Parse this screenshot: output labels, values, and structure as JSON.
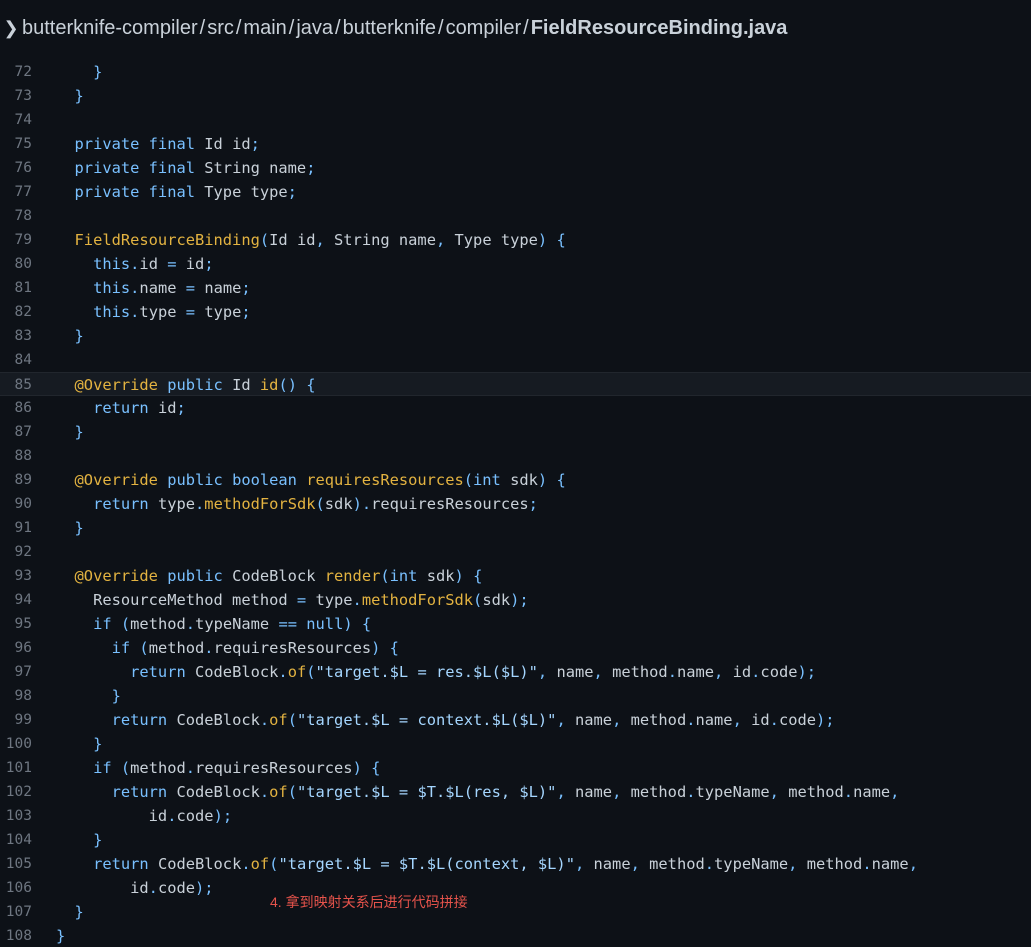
{
  "breadcrumb": {
    "parts": [
      "butterknife-compiler",
      "src",
      "main",
      "java",
      "butterknife",
      "compiler"
    ],
    "current": "FieldResourceBinding.java"
  },
  "lines": [
    {
      "n": "72",
      "t": [
        [
          "pl",
          "    }"
        ]
      ]
    },
    {
      "n": "73",
      "t": [
        [
          "pl",
          "  }"
        ]
      ]
    },
    {
      "n": "74",
      "t": []
    },
    {
      "n": "75",
      "t": [
        [
          "kw",
          "  private final "
        ],
        [
          "id",
          "Id id"
        ],
        [
          "pl",
          ";"
        ]
      ]
    },
    {
      "n": "76",
      "t": [
        [
          "kw",
          "  private final "
        ],
        [
          "id",
          "String name"
        ],
        [
          "pl",
          ";"
        ]
      ]
    },
    {
      "n": "77",
      "t": [
        [
          "kw",
          "  private final "
        ],
        [
          "id",
          "Type type"
        ],
        [
          "pl",
          ";"
        ]
      ]
    },
    {
      "n": "78",
      "t": []
    },
    {
      "n": "79",
      "t": [
        [
          "fnc",
          "  FieldResourceBinding"
        ],
        [
          "pl",
          "("
        ],
        [
          "id",
          "Id id"
        ],
        [
          "pl",
          ", "
        ],
        [
          "id",
          "String name"
        ],
        [
          "pl",
          ", "
        ],
        [
          "id",
          "Type type"
        ],
        [
          "pl",
          ") {"
        ]
      ]
    },
    {
      "n": "80",
      "t": [
        [
          "kw",
          "    this"
        ],
        [
          "pl",
          "."
        ],
        [
          "id",
          "id"
        ],
        [
          "pl",
          " = "
        ],
        [
          "id",
          "id"
        ],
        [
          "pl",
          ";"
        ]
      ]
    },
    {
      "n": "81",
      "t": [
        [
          "kw",
          "    this"
        ],
        [
          "pl",
          "."
        ],
        [
          "id",
          "name"
        ],
        [
          "pl",
          " = "
        ],
        [
          "id",
          "name"
        ],
        [
          "pl",
          ";"
        ]
      ]
    },
    {
      "n": "82",
      "t": [
        [
          "kw",
          "    this"
        ],
        [
          "pl",
          "."
        ],
        [
          "id",
          "type"
        ],
        [
          "pl",
          " = "
        ],
        [
          "id",
          "type"
        ],
        [
          "pl",
          ";"
        ]
      ]
    },
    {
      "n": "83",
      "t": [
        [
          "pl",
          "  }"
        ]
      ]
    },
    {
      "n": "84",
      "t": []
    },
    {
      "n": "85",
      "t": [
        [
          "fnc",
          "  @Override"
        ],
        [
          "kw",
          " public "
        ],
        [
          "id",
          "Id "
        ],
        [
          "fnc",
          "id"
        ],
        [
          "pl",
          "() {"
        ]
      ],
      "hl": true
    },
    {
      "n": "86",
      "t": [
        [
          "kw",
          "    return "
        ],
        [
          "id",
          "id"
        ],
        [
          "pl",
          ";"
        ]
      ]
    },
    {
      "n": "87",
      "t": [
        [
          "pl",
          "  }"
        ]
      ]
    },
    {
      "n": "88",
      "t": []
    },
    {
      "n": "89",
      "t": [
        [
          "fnc",
          "  @Override"
        ],
        [
          "kw",
          " public boolean "
        ],
        [
          "fnc",
          "requiresResources"
        ],
        [
          "pl",
          "("
        ],
        [
          "kw",
          "int "
        ],
        [
          "id",
          "sdk"
        ],
        [
          "pl",
          ") {"
        ]
      ]
    },
    {
      "n": "90",
      "t": [
        [
          "kw",
          "    return "
        ],
        [
          "id",
          "type"
        ],
        [
          "pl",
          "."
        ],
        [
          "fnc",
          "methodForSdk"
        ],
        [
          "pl",
          "("
        ],
        [
          "id",
          "sdk"
        ],
        [
          "pl",
          ")."
        ],
        [
          "id",
          "requiresResources"
        ],
        [
          "pl",
          ";"
        ]
      ]
    },
    {
      "n": "91",
      "t": [
        [
          "pl",
          "  }"
        ]
      ]
    },
    {
      "n": "92",
      "t": []
    },
    {
      "n": "93",
      "t": [
        [
          "fnc",
          "  @Override"
        ],
        [
          "kw",
          " public "
        ],
        [
          "id",
          "CodeBlock "
        ],
        [
          "fnc",
          "render"
        ],
        [
          "pl",
          "("
        ],
        [
          "kw",
          "int "
        ],
        [
          "id",
          "sdk"
        ],
        [
          "pl",
          ") {"
        ]
      ]
    },
    {
      "n": "94",
      "t": [
        [
          "id",
          "    ResourceMethod method"
        ],
        [
          "pl",
          " = "
        ],
        [
          "id",
          "type"
        ],
        [
          "pl",
          "."
        ],
        [
          "fnc",
          "methodForSdk"
        ],
        [
          "pl",
          "("
        ],
        [
          "id",
          "sdk"
        ],
        [
          "pl",
          ");"
        ]
      ]
    },
    {
      "n": "95",
      "t": [
        [
          "kw",
          "    if "
        ],
        [
          "pl",
          "("
        ],
        [
          "id",
          "method"
        ],
        [
          "pl",
          "."
        ],
        [
          "id",
          "typeName"
        ],
        [
          "pl",
          " == "
        ],
        [
          "kw",
          "null"
        ],
        [
          "pl",
          ") {"
        ]
      ]
    },
    {
      "n": "96",
      "t": [
        [
          "kw",
          "      if "
        ],
        [
          "pl",
          "("
        ],
        [
          "id",
          "method"
        ],
        [
          "pl",
          "."
        ],
        [
          "id",
          "requiresResources"
        ],
        [
          "pl",
          ") {"
        ]
      ]
    },
    {
      "n": "97",
      "t": [
        [
          "kw",
          "        return "
        ],
        [
          "id",
          "CodeBlock"
        ],
        [
          "pl",
          "."
        ],
        [
          "fnc",
          "of"
        ],
        [
          "pl",
          "("
        ],
        [
          "str",
          "\"target.$L = res.$L($L)\""
        ],
        [
          "pl",
          ", "
        ],
        [
          "id",
          "name"
        ],
        [
          "pl",
          ", "
        ],
        [
          "id",
          "method"
        ],
        [
          "pl",
          "."
        ],
        [
          "id",
          "name"
        ],
        [
          "pl",
          ", "
        ],
        [
          "id",
          "id"
        ],
        [
          "pl",
          "."
        ],
        [
          "id",
          "code"
        ],
        [
          "pl",
          ");"
        ]
      ]
    },
    {
      "n": "98",
      "t": [
        [
          "pl",
          "      }"
        ]
      ]
    },
    {
      "n": "99",
      "t": [
        [
          "kw",
          "      return "
        ],
        [
          "id",
          "CodeBlock"
        ],
        [
          "pl",
          "."
        ],
        [
          "fnc",
          "of"
        ],
        [
          "pl",
          "("
        ],
        [
          "str",
          "\"target.$L = context.$L($L)\""
        ],
        [
          "pl",
          ", "
        ],
        [
          "id",
          "name"
        ],
        [
          "pl",
          ", "
        ],
        [
          "id",
          "method"
        ],
        [
          "pl",
          "."
        ],
        [
          "id",
          "name"
        ],
        [
          "pl",
          ", "
        ],
        [
          "id",
          "id"
        ],
        [
          "pl",
          "."
        ],
        [
          "id",
          "code"
        ],
        [
          "pl",
          ");"
        ]
      ]
    },
    {
      "n": "100",
      "t": [
        [
          "pl",
          "    }"
        ]
      ]
    },
    {
      "n": "101",
      "t": [
        [
          "kw",
          "    if "
        ],
        [
          "pl",
          "("
        ],
        [
          "id",
          "method"
        ],
        [
          "pl",
          "."
        ],
        [
          "id",
          "requiresResources"
        ],
        [
          "pl",
          ") {"
        ]
      ]
    },
    {
      "n": "102",
      "t": [
        [
          "kw",
          "      return "
        ],
        [
          "id",
          "CodeBlock"
        ],
        [
          "pl",
          "."
        ],
        [
          "fnc",
          "of"
        ],
        [
          "pl",
          "("
        ],
        [
          "str",
          "\"target.$L = $T.$L(res, $L)\""
        ],
        [
          "pl",
          ", "
        ],
        [
          "id",
          "name"
        ],
        [
          "pl",
          ", "
        ],
        [
          "id",
          "method"
        ],
        [
          "pl",
          "."
        ],
        [
          "id",
          "typeName"
        ],
        [
          "pl",
          ", "
        ],
        [
          "id",
          "method"
        ],
        [
          "pl",
          "."
        ],
        [
          "id",
          "name"
        ],
        [
          "pl",
          ","
        ]
      ]
    },
    {
      "n": "103",
      "t": [
        [
          "id",
          "          id"
        ],
        [
          "pl",
          "."
        ],
        [
          "id",
          "code"
        ],
        [
          "pl",
          ");"
        ]
      ]
    },
    {
      "n": "104",
      "t": [
        [
          "pl",
          "    }"
        ]
      ]
    },
    {
      "n": "105",
      "t": [
        [
          "kw",
          "    return "
        ],
        [
          "id",
          "CodeBlock"
        ],
        [
          "pl",
          "."
        ],
        [
          "fnc",
          "of"
        ],
        [
          "pl",
          "("
        ],
        [
          "str",
          "\"target.$L = $T.$L(context, $L)\""
        ],
        [
          "pl",
          ", "
        ],
        [
          "id",
          "name"
        ],
        [
          "pl",
          ", "
        ],
        [
          "id",
          "method"
        ],
        [
          "pl",
          "."
        ],
        [
          "id",
          "typeName"
        ],
        [
          "pl",
          ", "
        ],
        [
          "id",
          "method"
        ],
        [
          "pl",
          "."
        ],
        [
          "id",
          "name"
        ],
        [
          "pl",
          ","
        ]
      ]
    },
    {
      "n": "106",
      "t": [
        [
          "id",
          "        id"
        ],
        [
          "pl",
          "."
        ],
        [
          "id",
          "code"
        ],
        [
          "pl",
          ");"
        ]
      ]
    },
    {
      "n": "107",
      "t": [
        [
          "pl",
          "  }"
        ]
      ]
    },
    {
      "n": "108",
      "t": [
        [
          "pl",
          "}"
        ]
      ]
    }
  ],
  "annotation_note": "4. 拿到映射关系后进行代码拼接",
  "colors": {
    "background": "#0d1117",
    "keyword": "#79c0ff",
    "identifier": "#c9d1d9",
    "function": "#e3b341",
    "string": "#a5d6ff",
    "note": "#e5534b"
  }
}
